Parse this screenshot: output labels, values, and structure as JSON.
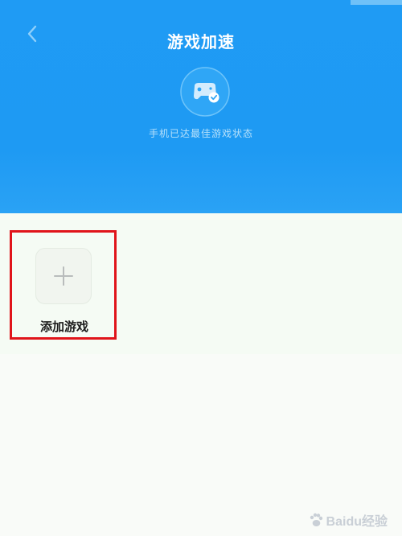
{
  "header": {
    "title": "游戏加速",
    "status_text": "手机已达最佳游戏状态"
  },
  "games": {
    "add_label": "添加游戏"
  },
  "watermark": {
    "text": "Baidu经验"
  },
  "colors": {
    "header_bg": "#1f9bf4",
    "highlight_border": "#e0141a",
    "page_bg": "#f8fbf7"
  }
}
